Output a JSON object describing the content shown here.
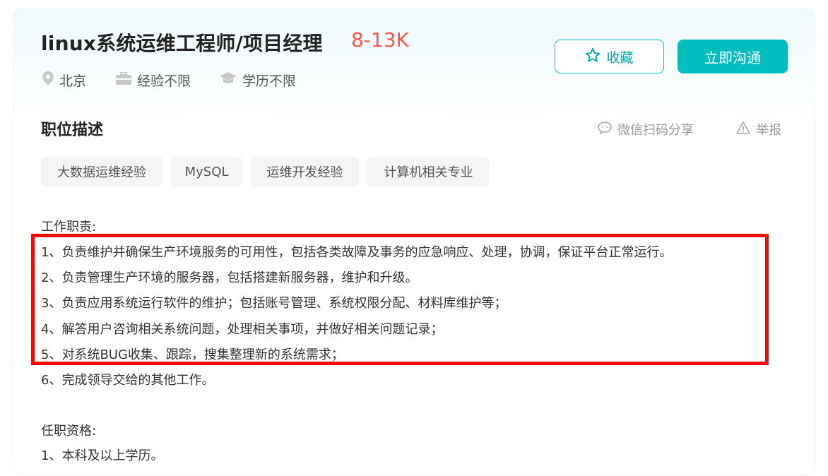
{
  "job": {
    "title": "linux系统运维工程师/项目经理",
    "salary": "8-13K",
    "city": "北京",
    "experience": "经验不限",
    "education": "学历不限"
  },
  "actions": {
    "fav_label": "收藏",
    "chat_label": "立即沟通"
  },
  "description": {
    "section_title": "职位描述",
    "share_label": "微信扫码分享",
    "report_label": "举报",
    "tags": [
      "大数据运维经验",
      "MySQL",
      "运维开发经验",
      "计算机相关专业"
    ],
    "duties_heading": "工作职责:",
    "duties": [
      "1、负责维护并确保生产环境服务的可用性，包括各类故障及事务的应急响应、处理，协调，保证平台正常运行。",
      "2、负责管理生产环境的服务器，包括搭建新服务器，维护和升级。",
      "3、负责应用系统运行软件的维护；包括账号管理、系统权限分配、材料库维护等；",
      "4、解答用户咨询相关系统问题，处理相关事项，并做好相关问题记录；",
      "5、对系统BUG收集、跟踪，搜集整理新的系统需求；",
      "6、完成领导交给的其他工作。"
    ],
    "qualifications_heading": "任职资格:",
    "qualifications": [
      "1、本科及以上学历。"
    ]
  },
  "colors": {
    "accent": "#00bebd",
    "salary": "#fe574a",
    "highlight": "#f00b0b"
  }
}
